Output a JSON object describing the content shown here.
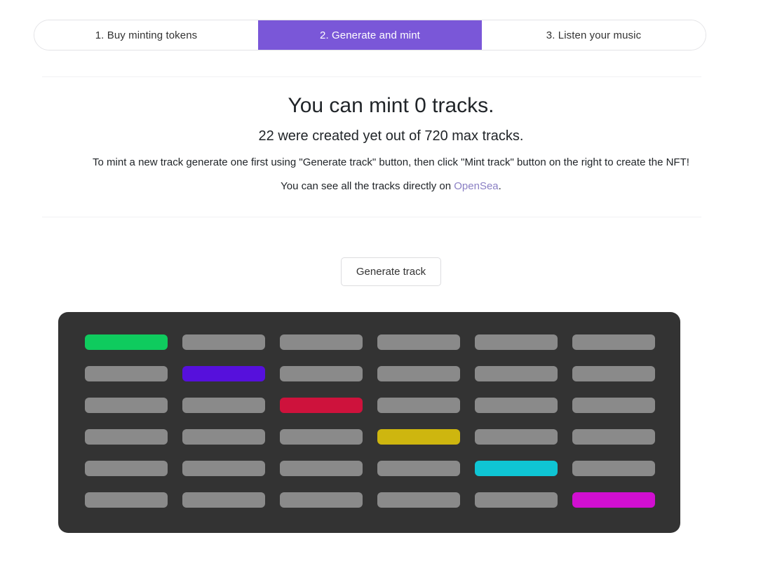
{
  "steps": {
    "tabs": [
      {
        "label": "1. Buy minting tokens",
        "active": false
      },
      {
        "label": "2. Generate and mint",
        "active": true
      },
      {
        "label": "3. Listen your music",
        "active": false
      }
    ]
  },
  "info": {
    "headline": "You can mint 0 tracks.",
    "subline": "22 were created yet out of 720 max tracks.",
    "hint": "To mint a new track generate one first using \"Generate track\" button, then click \"Mint track\" button on the right to create the NFT!",
    "hint_prefix": "You can see all the tracks directly on ",
    "link_label": "OpenSea",
    "hint_suffix": ".",
    "mintable_count": 0,
    "created_count": 22,
    "max_tracks": 720
  },
  "actions": {
    "generate_label": "Generate track"
  },
  "tracks": {
    "rows": 6,
    "columns": 6,
    "empty_color": "#8a8a8a",
    "panel_color": "#333333",
    "cells": [
      [
        "#0fcb5e",
        "#8a8a8a",
        "#8a8a8a",
        "#8a8a8a",
        "#8a8a8a",
        "#8a8a8a"
      ],
      [
        "#8a8a8a",
        "#5610dc",
        "#8a8a8a",
        "#8a8a8a",
        "#8a8a8a",
        "#8a8a8a"
      ],
      [
        "#8a8a8a",
        "#8a8a8a",
        "#ce123c",
        "#8a8a8a",
        "#8a8a8a",
        "#8a8a8a"
      ],
      [
        "#8a8a8a",
        "#8a8a8a",
        "#8a8a8a",
        "#ceb60f",
        "#8a8a8a",
        "#8a8a8a"
      ],
      [
        "#8a8a8a",
        "#8a8a8a",
        "#8a8a8a",
        "#8a8a8a",
        "#0fc5d4",
        "#8a8a8a"
      ],
      [
        "#8a8a8a",
        "#8a8a8a",
        "#8a8a8a",
        "#8a8a8a",
        "#8a8a8a",
        "#d10fd1"
      ]
    ]
  },
  "theme": {
    "accent": "#7a57d8",
    "link": "#8a7fc4",
    "text": "#212529",
    "divider": "#f1f1f3"
  }
}
